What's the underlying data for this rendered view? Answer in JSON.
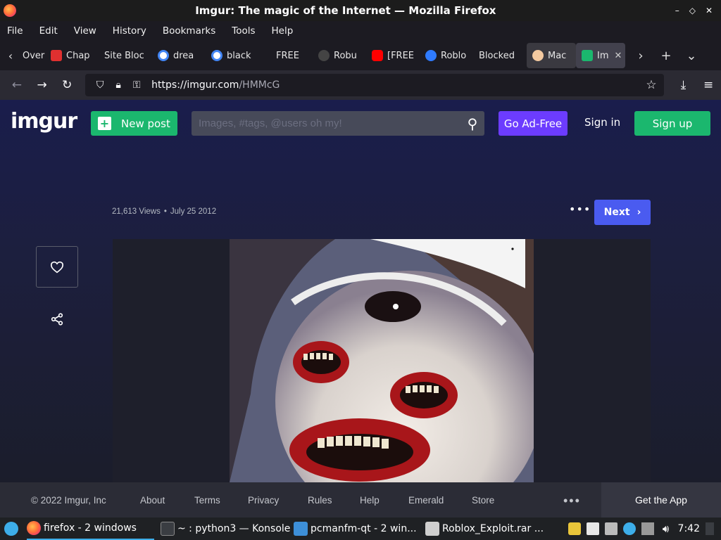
{
  "window": {
    "title": "Imgur: The magic of the Internet — Mozilla Firefox",
    "controls": [
      "–",
      "◇",
      "✕"
    ]
  },
  "menu": [
    "File",
    "Edit",
    "View",
    "History",
    "Bookmarks",
    "Tools",
    "Help"
  ],
  "tabs": [
    {
      "label": "Over",
      "fav": "#6b6b6b"
    },
    {
      "label": "Chap",
      "fav": "#e03030"
    },
    {
      "label": "Site Bloc",
      "fav": ""
    },
    {
      "label": "drea",
      "fav": "#ffffff"
    },
    {
      "label": "black",
      "fav": "#ffffff"
    },
    {
      "label": "FREE",
      "fav": ""
    },
    {
      "label": "Robu",
      "fav": "#555555"
    },
    {
      "label": "[FREE",
      "fav": "#ff0000"
    },
    {
      "label": "Roblo",
      "fav": "#2f7bff"
    },
    {
      "label": "Blocked",
      "fav": ""
    },
    {
      "label": "Mac",
      "fav": "#f3c9a0"
    },
    {
      "label": "Im",
      "fav": "#1bb76e"
    }
  ],
  "nav": {
    "url_host": "https://imgur.com",
    "url_path": "/HMMcG"
  },
  "imgur": {
    "logo": "imgur",
    "new_post": "New post",
    "search_placeholder": "Images, #tags, @users oh my!",
    "ad_free": "Go Ad-Free",
    "sign_in": "Sign in",
    "sign_up": "Sign up"
  },
  "post": {
    "views": "21,613 Views",
    "date": "July 25 2012",
    "next": "Next"
  },
  "footer": {
    "items": [
      "© 2022 Imgur, Inc",
      "About",
      "Terms",
      "Privacy",
      "Rules",
      "Help",
      "Emerald",
      "Store"
    ],
    "get_app": "Get the App"
  },
  "taskbar": {
    "items": [
      "firefox - 2 windows",
      "~ : python3 — Konsole",
      "pcmanfm-qt - 2 win...",
      "Roblox_Exploit.rar ..."
    ],
    "clock": "7:42"
  },
  "colors": {
    "green": "#1bb76e",
    "purple": "#6c3cff",
    "blue": "#4a5bf0"
  }
}
